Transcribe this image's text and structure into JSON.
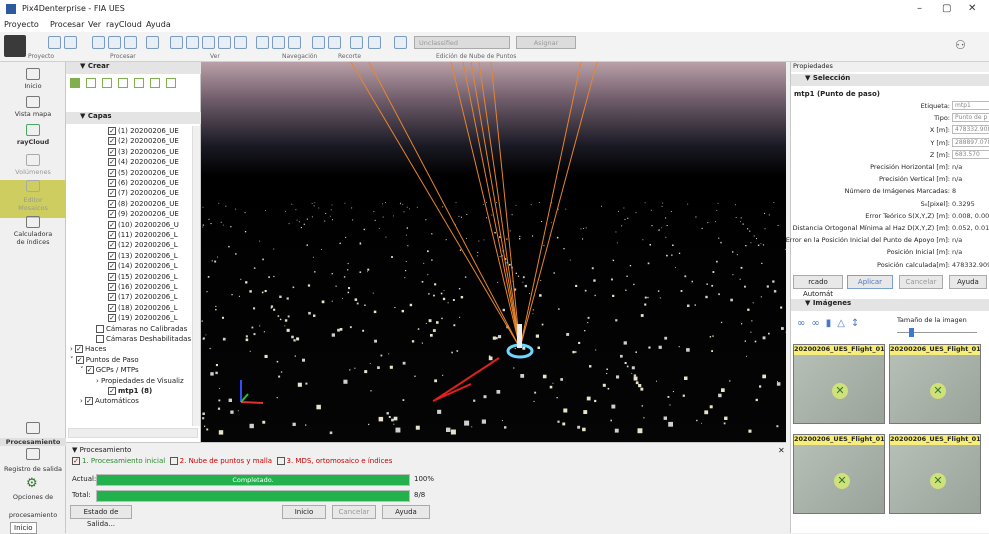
{
  "window": {
    "title": "Pix4Denterprise - FIA UES"
  },
  "menu": [
    "Proyecto",
    "Procesar",
    "Ver",
    "rayCloud",
    "Ayuda"
  ],
  "toolbar": {
    "groups": [
      "Proyecto",
      "Procesar",
      "Ver",
      "Navegación",
      "Recorte",
      "Edición de Nube de Puntos"
    ],
    "class_dropdown": "Unclassified",
    "assign_label": "Asignar"
  },
  "nav": [
    {
      "label": "Inicio",
      "icon": "home-icon"
    },
    {
      "label": "Vista mapa",
      "icon": "map-icon"
    },
    {
      "label": "rayCloud",
      "icon": "raycloud-icon"
    },
    {
      "label": "Volúmenes",
      "icon": "volume-icon"
    },
    {
      "label": "Editor",
      "icon": "editor-icon"
    },
    {
      "label": "Mosaicos",
      "icon": "mosaic-icon"
    },
    {
      "label": "Calculadora",
      "icon": "calculator-icon"
    },
    {
      "label": "de índices",
      "icon": "index-icon"
    },
    {
      "label": "Procesamiento",
      "icon": "processing-icon"
    },
    {
      "label": "Registro de salida",
      "icon": "log-icon"
    },
    {
      "label": "Opciones de",
      "icon": "gear-icon"
    },
    {
      "label": "procesamiento",
      "icon": "options-icon"
    }
  ],
  "status_tab": "Inicio",
  "layers": {
    "crear_title": "Crear",
    "capas_title": "Capas",
    "items": [
      "(1) 20200206_UE",
      "(2) 20200206_UE",
      "(3) 20200206_UE",
      "(4) 20200206_UE",
      "(5) 20200206_UE",
      "(6) 20200206_UE",
      "(7) 20200206_UE",
      "(8) 20200206_UE",
      "(9) 20200206_UE",
      "(10) 20200206_U",
      "(11) 20200206_L",
      "(12) 20200206_L",
      "(13) 20200206_L",
      "(14) 20200206_L",
      "(15) 20200206_L",
      "(16) 20200206_L",
      "(17) 20200206_L",
      "(18) 20200206_L",
      "(19) 20200206_L"
    ],
    "cam_uncal": "Cámaras no Calibradas",
    "cam_disabled": "Cámaras Deshabilitadas",
    "haces": "Haces",
    "puntos_paso": "Puntos de Paso",
    "gcps": "GCPs / MTPs",
    "visual_props": "Propiedades de Visualiz",
    "mtp1": "mtp1 (8)",
    "auto": "Automáticos"
  },
  "processing": {
    "title": "Procesamiento",
    "step1": "1. Procesamiento inicial",
    "step2": "2. Nube de puntos y malla",
    "step3": "3. MDS, ortomosaico e índices",
    "actual_label": "Actual:",
    "total_label": "Total:",
    "bar_text": "Completado.",
    "actual_value": "100%",
    "total_value": "8/8",
    "actual_progress": 1.0,
    "total_progress": 1.0,
    "btn_output": "Estado de Salida...",
    "btn_start": "Inicio",
    "btn_cancel": "Cancelar",
    "btn_help": "Ayuda"
  },
  "properties": {
    "title": "Propiedades",
    "selection_title": "Selección",
    "point_name": "mtp1 (Punto de paso)",
    "fields": [
      {
        "label": "Etiqueta:",
        "value": "mtp1"
      },
      {
        "label": "Tipo:",
        "value": "Punto de p"
      },
      {
        "label": "X [m]:",
        "value": "478332.908"
      },
      {
        "label": "Y [m]:",
        "value": "288897.078"
      },
      {
        "label": "Z [m]:",
        "value": "683.570"
      },
      {
        "label": "Precisión Horizontal [m]:",
        "value": "n/a"
      },
      {
        "label": "Precisión Vertical [m]:",
        "value": "n/a"
      },
      {
        "label": "Número de Imágenes Marcadas:",
        "value": "8"
      },
      {
        "label": "S₀[pixel]:",
        "value": "0.3295"
      },
      {
        "label": "Error Teórico S(X,Y,Z) [m]:",
        "value": "0.008, 0.008"
      },
      {
        "label": "Distancia Ortogonal Mínima al Haz D(X,Y,Z) [m]:",
        "value": "0.052, 0.011"
      },
      {
        "label": "Error en la Posición Inicial del Punto de Apoyo [m]:",
        "value": "n/a"
      },
      {
        "label": "Posición Inicial [m]:",
        "value": "n/a"
      },
      {
        "label": "Posición calculada[m]:",
        "value": "478332.909,"
      }
    ],
    "btn_auto": "rcado Automát",
    "btn_apply": "Aplicar",
    "btn_cancel": "Cancelar",
    "btn_help": "Ayuda",
    "images_title": "Imágenes",
    "image_size_label": "Tamaño de la imagen",
    "thumbs": [
      "20200206_UES_Flight_01",
      "20200206_UES_Flight_01",
      "20200206_UES_Flight_01",
      "20200206_UES_Flight_01"
    ]
  }
}
